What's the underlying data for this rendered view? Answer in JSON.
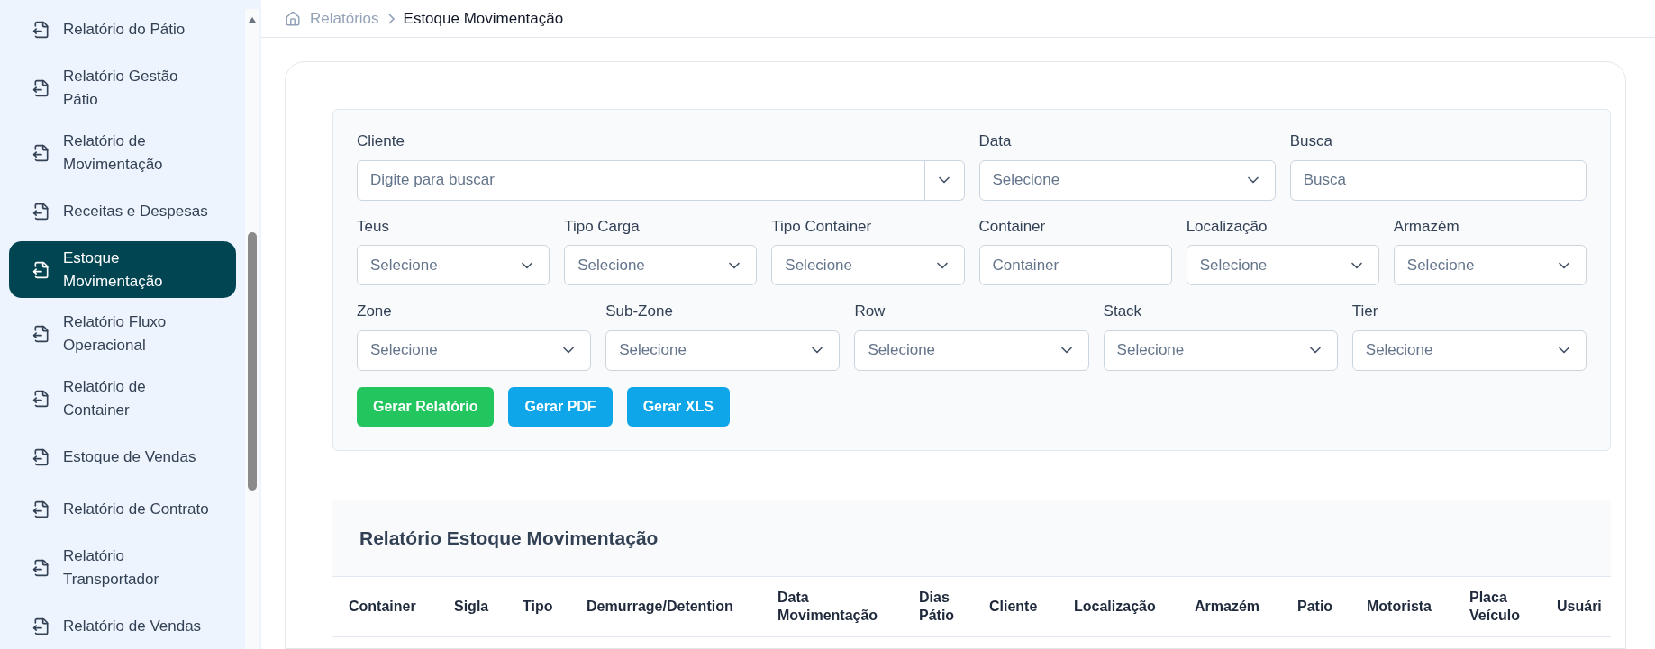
{
  "sidebar": {
    "items": [
      {
        "label": "Relatório do Pátio",
        "selected": false
      },
      {
        "label": "Relatório Gestão Pátio",
        "selected": false
      },
      {
        "label": "Relatório de Movimentação",
        "selected": false
      },
      {
        "label": "Receitas e Despesas",
        "selected": false
      },
      {
        "label": "Estoque Movimentação",
        "selected": true
      },
      {
        "label": "Relatório Fluxo Operacional",
        "selected": false
      },
      {
        "label": "Relatório de Container",
        "selected": false
      },
      {
        "label": "Estoque de Vendas",
        "selected": false
      },
      {
        "label": "Relatório de Contrato",
        "selected": false
      },
      {
        "label": "Relatório Transportador",
        "selected": false
      },
      {
        "label": "Relatório de Vendas",
        "selected": false
      }
    ]
  },
  "breadcrumb": {
    "parent": "Relatórios",
    "current": "Estoque Movimentação"
  },
  "filters": [
    [
      {
        "label": "Cliente",
        "kind": "combo",
        "placeholder": "Digite para buscar"
      },
      {
        "label": "Data",
        "kind": "select",
        "placeholder": "Selecione"
      },
      {
        "label": "Busca",
        "kind": "text",
        "placeholder": "Busca"
      }
    ],
    [
      {
        "label": "Teus",
        "kind": "select",
        "placeholder": "Selecione"
      },
      {
        "label": "Tipo Carga",
        "kind": "select",
        "placeholder": "Selecione"
      },
      {
        "label": "Tipo Container",
        "kind": "select",
        "placeholder": "Selecione"
      },
      {
        "label": "Container",
        "kind": "text",
        "placeholder": "Container"
      },
      {
        "label": "Localização",
        "kind": "select",
        "placeholder": "Selecione"
      },
      {
        "label": "Armazém",
        "kind": "select",
        "placeholder": "Selecione"
      }
    ],
    [
      {
        "label": "Zone",
        "kind": "select",
        "placeholder": "Selecione"
      },
      {
        "label": "Sub-Zone",
        "kind": "select",
        "placeholder": "Selecione"
      },
      {
        "label": "Row",
        "kind": "select",
        "placeholder": "Selecione"
      },
      {
        "label": "Stack",
        "kind": "select",
        "placeholder": "Selecione"
      },
      {
        "label": "Tier",
        "kind": "select",
        "placeholder": "Selecione"
      }
    ]
  ],
  "buttons": [
    {
      "label": "Gerar Relatório",
      "color": "#22c55e"
    },
    {
      "label": "Gerar PDF",
      "color": "#0ea5e9"
    },
    {
      "label": "Gerar XLS",
      "color": "#0ea5e9"
    }
  ],
  "table": {
    "title": "Relatório Estoque Movimentação",
    "columns": [
      "Container",
      "Sigla",
      "Tipo",
      "Demurrage/Detention",
      "Data Movimentação",
      "Dias Pátio",
      "Cliente",
      "Localização",
      "Armazém",
      "Patio",
      "Motorista",
      "Placa Veículo",
      "Usuári"
    ]
  }
}
